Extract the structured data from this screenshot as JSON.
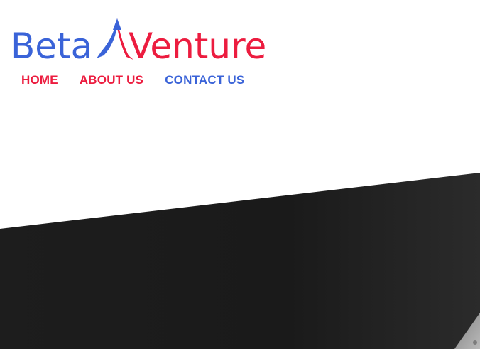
{
  "logo": {
    "part1": "Beta",
    "part2": "Venture",
    "colors": {
      "beta": "#3a63d8",
      "venture": "#ec1c3f",
      "arrow_blue": "#3a63d8",
      "arrow_red": "#ec1c3f"
    }
  },
  "nav": {
    "items": [
      {
        "label": "HOME",
        "color": "#ec1c3f"
      },
      {
        "label": "ABOUT US",
        "color": "#ec1c3f"
      },
      {
        "label": "CONTACT US",
        "color": "#3a63d8"
      }
    ]
  },
  "hero": {
    "background_color": "#1c1c1c"
  }
}
